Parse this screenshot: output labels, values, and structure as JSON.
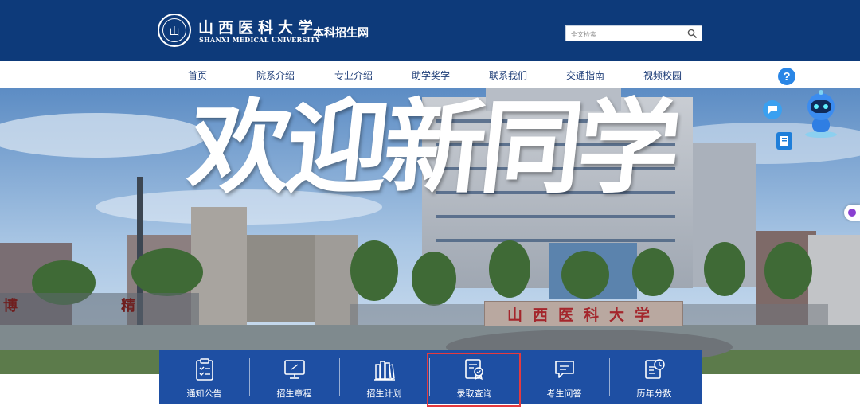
{
  "header": {
    "logo_glyph": "山",
    "university_name_cn": "山西医科大学",
    "university_name_en": "SHANXI MEDICAL UNIVERSITY",
    "site_name": "本科招生网",
    "search": {
      "placeholder": "全文检索",
      "icon": "search-icon"
    },
    "background_color": "#0d3a7a"
  },
  "nav": {
    "items": [
      {
        "label": "首页"
      },
      {
        "label": "院系介绍"
      },
      {
        "label": "专业介绍"
      },
      {
        "label": "助学奖学"
      },
      {
        "label": "联系我们"
      },
      {
        "label": "交通指南"
      },
      {
        "label": "视频校园"
      }
    ],
    "help_glyph": "?",
    "text_color": "#1f3e78"
  },
  "banner": {
    "headline": "欢迎新同学",
    "gate_sign": "山西医科大学",
    "side_text_left": "博",
    "side_text_right": "精"
  },
  "widgets": {
    "chat_icon": "chat-bubble-icon",
    "guide_icon": "book-icon",
    "assistant_icon": "robot-icon",
    "side_tab_icon": "side-tab-icon"
  },
  "quick_links": [
    {
      "label": "通知公告",
      "icon": "clipboard-icon"
    },
    {
      "label": "招生章程",
      "icon": "monitor-icon"
    },
    {
      "label": "招生计划",
      "icon": "books-icon"
    },
    {
      "label": "录取查询",
      "icon": "certificate-icon",
      "highlighted": true
    },
    {
      "label": "考生问答",
      "icon": "message-icon"
    },
    {
      "label": "历年分数",
      "icon": "score-history-icon"
    }
  ],
  "colors": {
    "quick_bar": "#1e4fa3",
    "highlight_border": "#e53a3f"
  }
}
